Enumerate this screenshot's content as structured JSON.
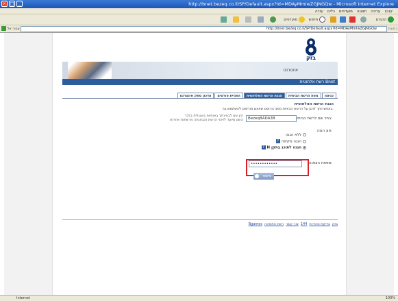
{
  "window": {
    "title": "http://bnet.bezeq.co.il/SP/Default.aspx?Id=MDAyMmIwZGJNGQw - Microsoft Internet Explore"
  },
  "menu": {
    "items": [
      "קובץ",
      "עריכה",
      "תצוגה",
      "מועדפים",
      "כלים",
      "עזרה"
    ]
  },
  "toolbar": {
    "back_label": "הקודם",
    "search_label": "חיפוש",
    "favorites_label": "מועדפים"
  },
  "address": {
    "label": "כתובת",
    "url": "http://bnet.bezeq.co.il/SP/Default.aspx?Id=MDAyMmIwZGJNGQw",
    "go_label": "עבור אל",
    "links_label": "קישורים"
  },
  "page": {
    "logo_text": "בזק",
    "banner_label": "אינטרנט",
    "subtitle": "רשת אלחוטית Bnet",
    "tabs": [
      {
        "label": "כניסה",
        "active": false
      },
      {
        "label": "מפת הרשת הביתית",
        "active": false
      },
      {
        "label": "הגנת הרשת האלחוטית",
        "active": true
      },
      {
        "label": "הפניית פורטים",
        "active": false
      },
      {
        "label": "עדכון ספק אינטרנט",
        "active": false
      }
    ],
    "panel_title": "הגנת הרשת האלחוטית",
    "panel_desc": "באפשרותך להגן על הרשת הביתית מפני גורמים שאינם מורשים להשתמש בה.",
    "network_name_label": "בחר שם לרשת הביתית:",
    "network_name_value": "BezeqBADA3B",
    "network_name_hint": "הזן שם לבחירתך באותיות באנגלית בלבד\nהשם מיועד לזיהוי הרשת והבחנתה מרשתות אחרות",
    "protection_type_label": "סוג הגנה:",
    "options": [
      {
        "label": "ללא הגנה",
        "selected": false,
        "help": false
      },
      {
        "label": "הגנה מקיפה",
        "selected": false,
        "help": true
      },
      {
        "label": "הגנה לתוכנ בתקן N",
        "selected": true,
        "help": true
      }
    ],
    "key_label": "מפתח הצפנה:",
    "key_value": "••••••••••••",
    "submit_label": "אישור",
    "footer_links": [
      "בזק",
      "בדיקת מהירות",
      "144",
      "צור קשר",
      "רשת התמיכה",
      "Bgames"
    ]
  },
  "status": {
    "zone": "Internet",
    "zoom": "100%"
  },
  "colors": {
    "accent": "#2c5e9e",
    "highlight_box": "#d4212a"
  }
}
